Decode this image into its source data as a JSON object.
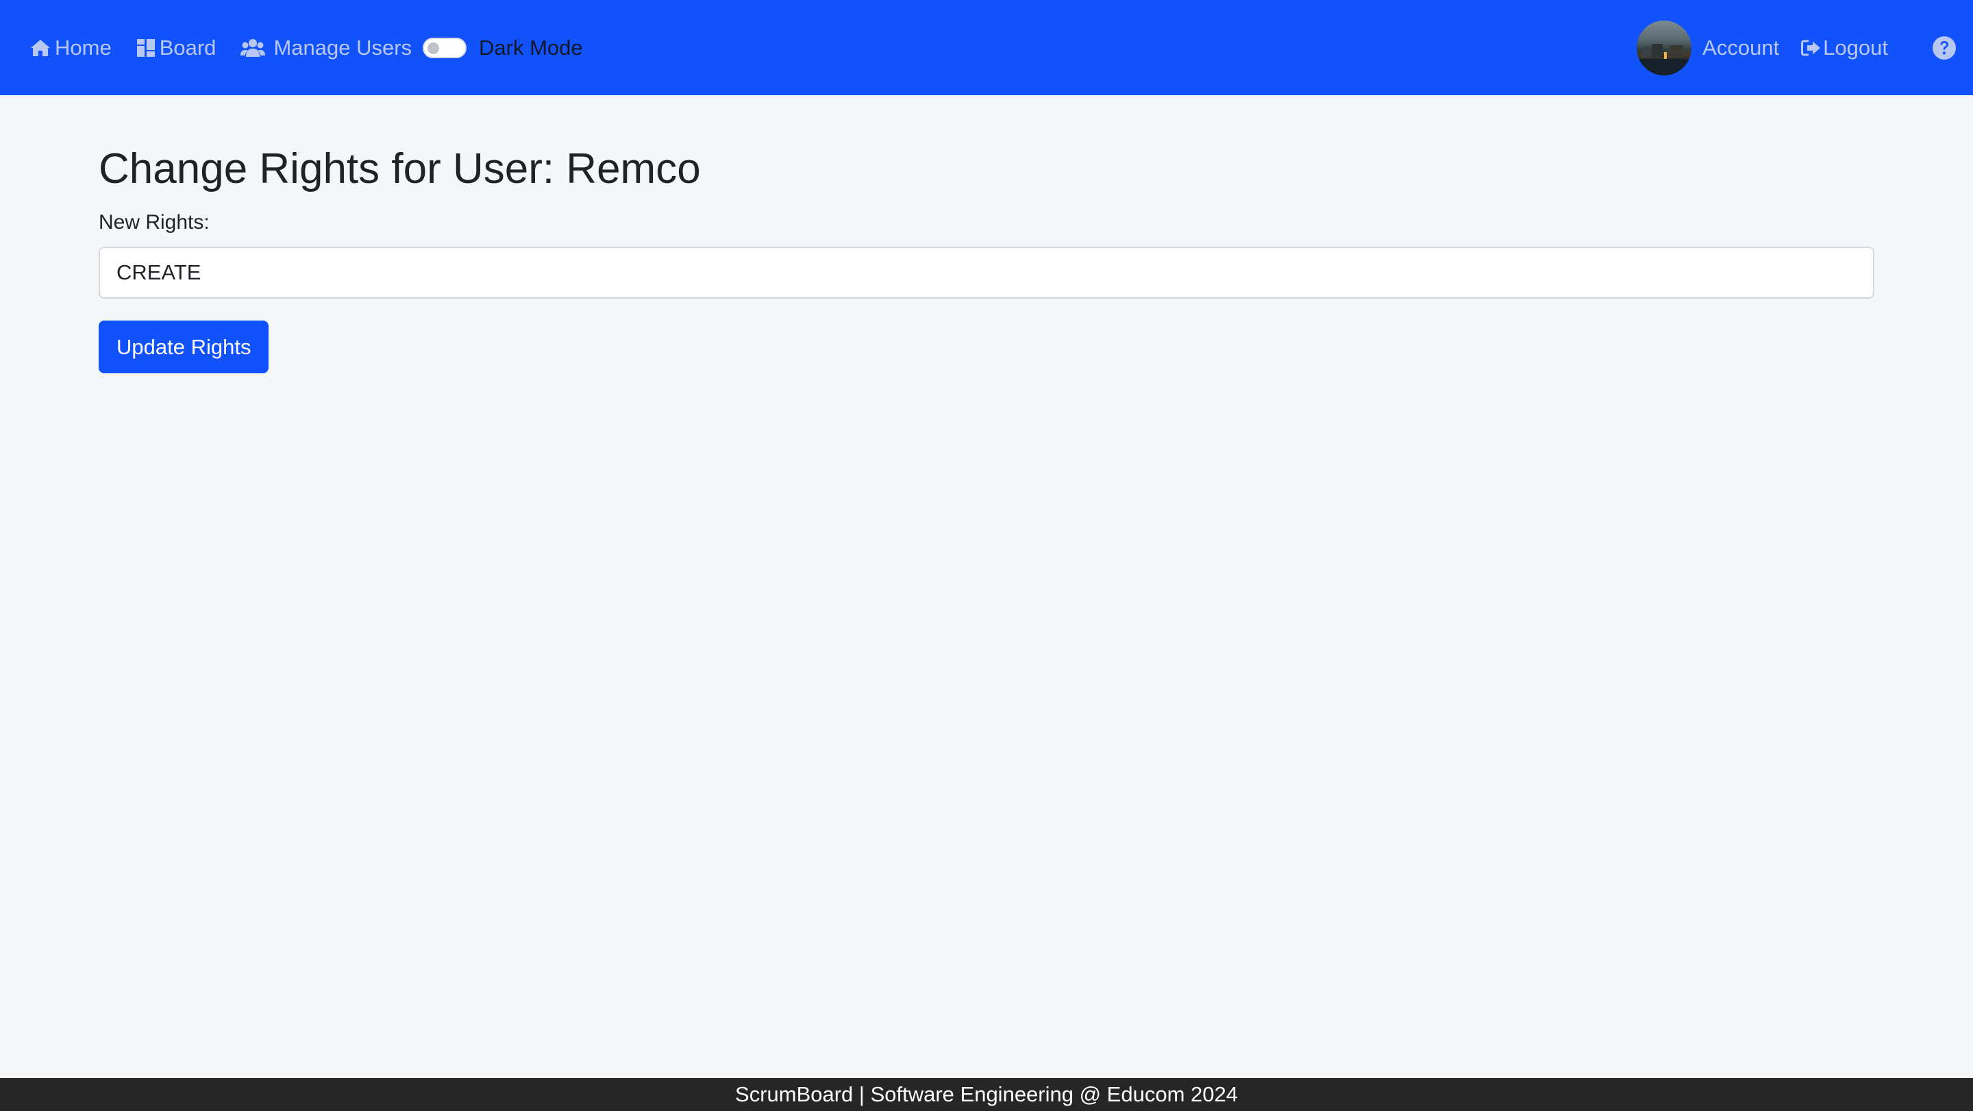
{
  "nav": {
    "home_label": "Home",
    "home_icon": "home-icon",
    "board_label": "Board",
    "board_icon": "board-icon",
    "manage_users_label": "Manage Users",
    "manage_users_icon": "users-icon",
    "dark_mode_label": "Dark Mode",
    "dark_mode_enabled": false,
    "account_label": "Account",
    "logout_label": "Logout",
    "logout_icon": "logout-icon",
    "help_icon": "question-circle-icon",
    "background_color": "#1152fb"
  },
  "page": {
    "title": "Change Rights for User: Remco",
    "field_label": "New Rights:",
    "rights_value": "CREATE",
    "submit_label": "Update Rights"
  },
  "footer": {
    "text": "ScrumBoard | Software Engineering @ Educom 2024"
  }
}
